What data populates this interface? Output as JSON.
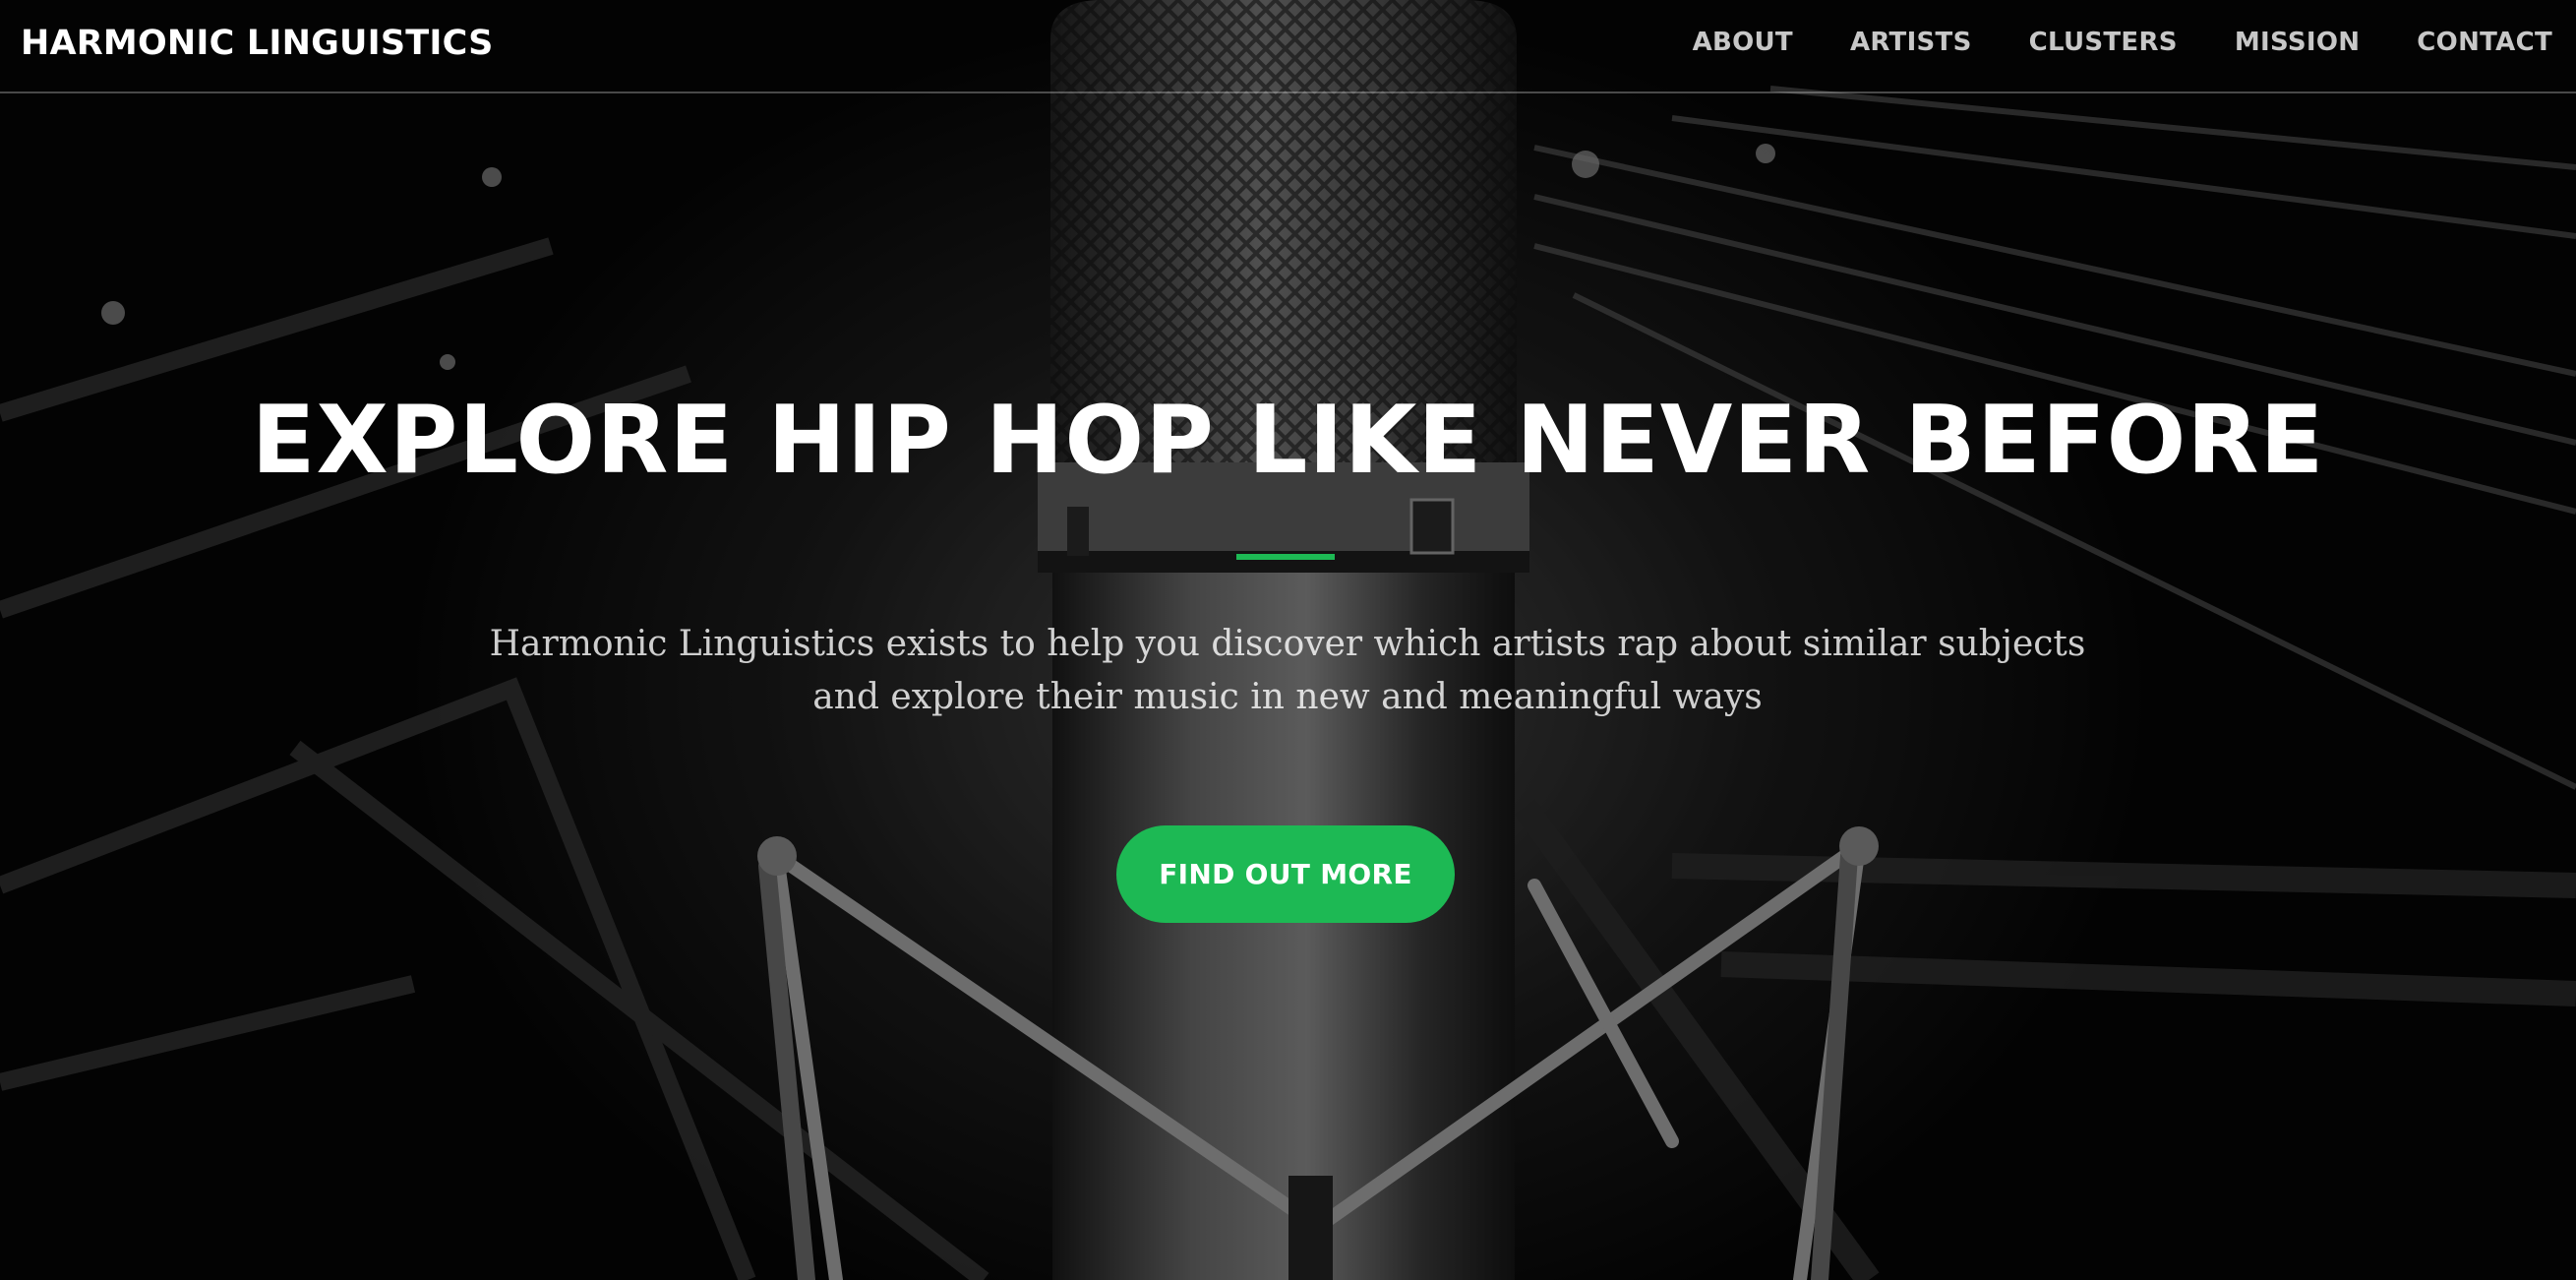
{
  "navbar": {
    "brand": "HARMONIC LINGUISTICS",
    "links": [
      {
        "label": "ABOUT"
      },
      {
        "label": "ARTISTS"
      },
      {
        "label": "CLUSTERS"
      },
      {
        "label": "MISSION"
      },
      {
        "label": "CONTACT"
      }
    ]
  },
  "hero": {
    "headline": "EXPLORE HIP HOP LIKE NEVER BEFORE",
    "lead_line_1": "Harmonic Linguistics exists to help you discover which artists rap about similar subjects",
    "lead_line_2": "and explore their music in new and meaningful ways",
    "cta_label": "FIND OUT MORE",
    "background_image": "studio-microphone-photo"
  },
  "colors": {
    "accent": "#1db954",
    "nav_text": "#ffffff",
    "background": "#000000"
  }
}
